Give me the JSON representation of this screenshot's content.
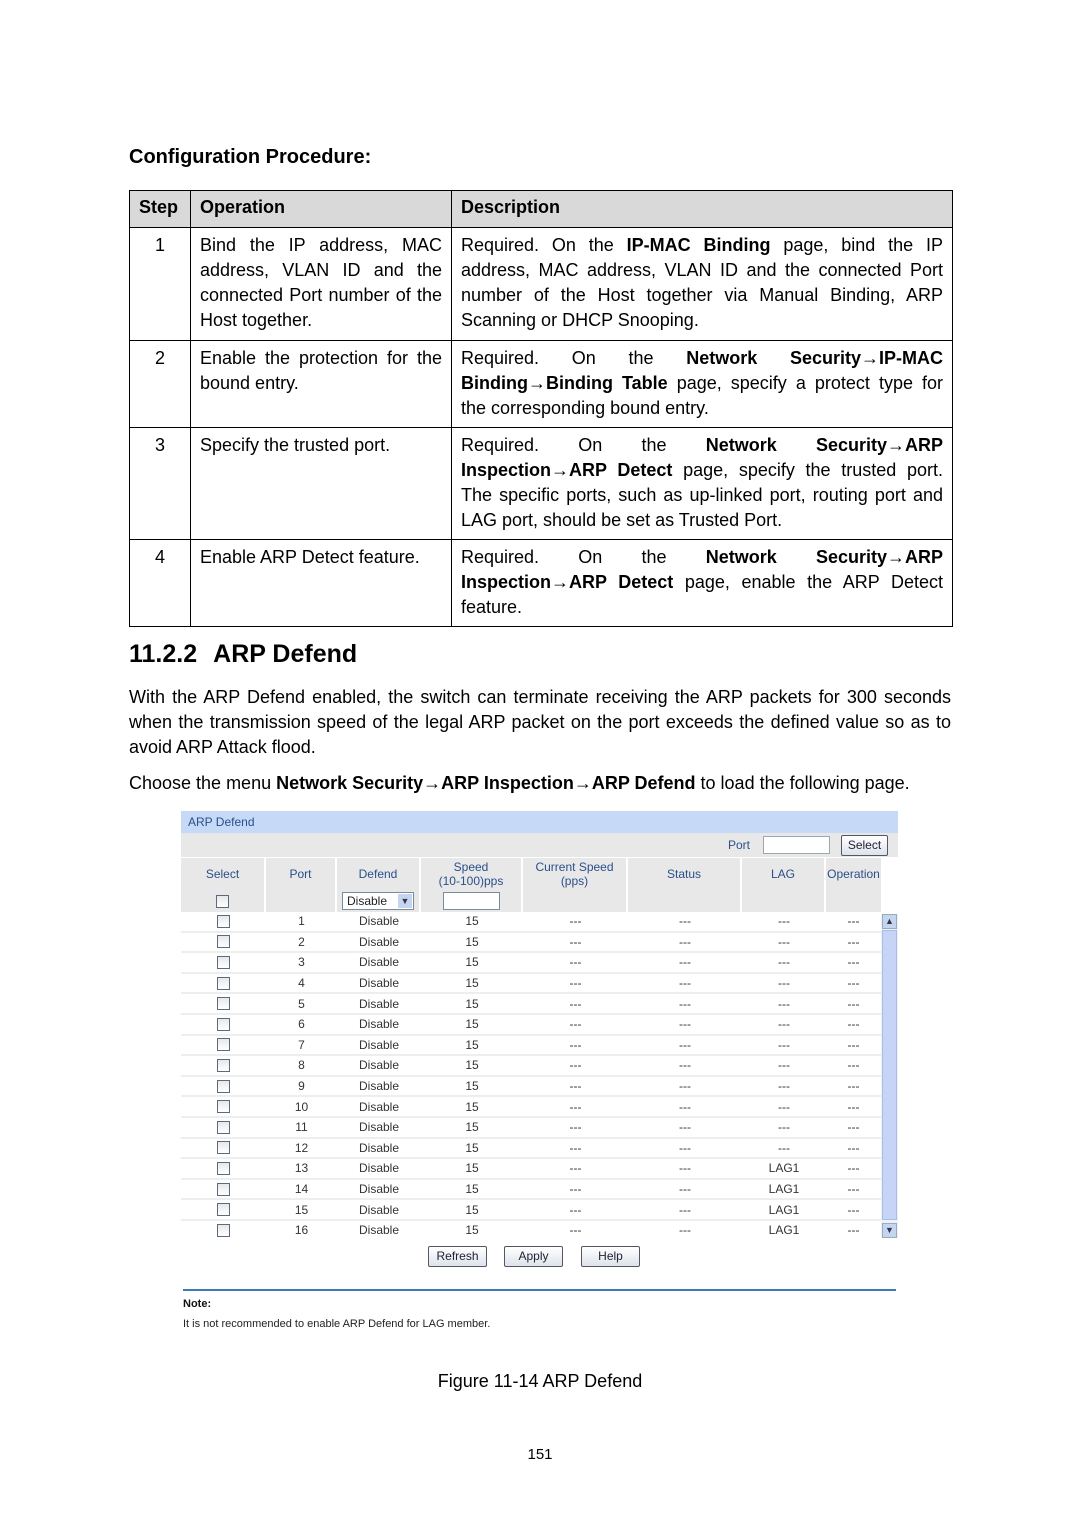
{
  "config_title": "Configuration Procedure:",
  "table": {
    "headers": [
      "Step",
      "Operation",
      "Description"
    ],
    "rows": [
      {
        "step": "1",
        "operation": "Bind the IP address, MAC address, VLAN ID and the connected Port number of the Host together.",
        "description": [
          {
            "t": "Required. On the "
          },
          {
            "t": "IP-MAC Binding",
            "b": true
          },
          {
            "t": " page, bind the IP address, MAC address, VLAN ID and the connected Port number of the Host together via Manual Binding, ARP Scanning or DHCP Snooping."
          }
        ]
      },
      {
        "step": "2",
        "operation": "Enable the protection for the bound entry.",
        "description": [
          {
            "t": "Required. On the "
          },
          {
            "t": "Network Security→IP-MAC Binding→Binding Table",
            "b": true
          },
          {
            "t": " page, specify a protect type for the corresponding bound entry."
          }
        ]
      },
      {
        "step": "3",
        "operation": "Specify the trusted port.",
        "description": [
          {
            "t": "Required. On the "
          },
          {
            "t": "Network Security→ARP Inspection→ARP Detect",
            "b": true
          },
          {
            "t": " page, specify the trusted port. The specific ports, such as up-linked port, routing port and LAG port, should be set as Trusted Port."
          }
        ]
      },
      {
        "step": "4",
        "operation": "Enable ARP Detect feature.",
        "description": [
          {
            "t": "Required. On the "
          },
          {
            "t": "Network Security→ARP Inspection→ARP Detect",
            "b": true
          },
          {
            "t": " page, enable the ARP Detect feature."
          }
        ]
      }
    ]
  },
  "section": {
    "number": "11.2.2",
    "title": "ARP Defend"
  },
  "paragraphs": [
    [
      {
        "t": "With the ARP Defend enabled, the switch can terminate receiving the ARP packets for 300 seconds when the transmission speed of the legal ARP packet on the port exceeds the defined value so as to avoid ARP Attack flood."
      }
    ],
    [
      {
        "t": "Choose the menu "
      },
      {
        "t": "Network Security→ARP Inspection→ARP Defend",
        "b": true
      },
      {
        "t": " to load the following page."
      }
    ]
  ],
  "ui": {
    "title": "ARP Defend",
    "port_label": "Port",
    "port_value": "",
    "select_button": "Select",
    "columns": [
      "Select",
      "Port",
      "Defend",
      "Speed\n(10-100)pps",
      "Current Speed\n(pps)",
      "Status",
      "LAG",
      "Operation"
    ],
    "filter": {
      "defend": "Disable",
      "speed": ""
    },
    "rows": [
      {
        "port": "1",
        "defend": "Disable",
        "speed": "15",
        "current": "---",
        "status": "---",
        "lag": "---",
        "op": "---"
      },
      {
        "port": "2",
        "defend": "Disable",
        "speed": "15",
        "current": "---",
        "status": "---",
        "lag": "---",
        "op": "---"
      },
      {
        "port": "3",
        "defend": "Disable",
        "speed": "15",
        "current": "---",
        "status": "---",
        "lag": "---",
        "op": "---"
      },
      {
        "port": "4",
        "defend": "Disable",
        "speed": "15",
        "current": "---",
        "status": "---",
        "lag": "---",
        "op": "---"
      },
      {
        "port": "5",
        "defend": "Disable",
        "speed": "15",
        "current": "---",
        "status": "---",
        "lag": "---",
        "op": "---"
      },
      {
        "port": "6",
        "defend": "Disable",
        "speed": "15",
        "current": "---",
        "status": "---",
        "lag": "---",
        "op": "---"
      },
      {
        "port": "7",
        "defend": "Disable",
        "speed": "15",
        "current": "---",
        "status": "---",
        "lag": "---",
        "op": "---"
      },
      {
        "port": "8",
        "defend": "Disable",
        "speed": "15",
        "current": "---",
        "status": "---",
        "lag": "---",
        "op": "---"
      },
      {
        "port": "9",
        "defend": "Disable",
        "speed": "15",
        "current": "---",
        "status": "---",
        "lag": "---",
        "op": "---"
      },
      {
        "port": "10",
        "defend": "Disable",
        "speed": "15",
        "current": "---",
        "status": "---",
        "lag": "---",
        "op": "---"
      },
      {
        "port": "11",
        "defend": "Disable",
        "speed": "15",
        "current": "---",
        "status": "---",
        "lag": "---",
        "op": "---"
      },
      {
        "port": "12",
        "defend": "Disable",
        "speed": "15",
        "current": "---",
        "status": "---",
        "lag": "---",
        "op": "---"
      },
      {
        "port": "13",
        "defend": "Disable",
        "speed": "15",
        "current": "---",
        "status": "---",
        "lag": "LAG1",
        "op": "---"
      },
      {
        "port": "14",
        "defend": "Disable",
        "speed": "15",
        "current": "---",
        "status": "---",
        "lag": "LAG1",
        "op": "---"
      },
      {
        "port": "15",
        "defend": "Disable",
        "speed": "15",
        "current": "---",
        "status": "---",
        "lag": "LAG1",
        "op": "---"
      },
      {
        "port": "16",
        "defend": "Disable",
        "speed": "15",
        "current": "---",
        "status": "---",
        "lag": "LAG1",
        "op": "---"
      }
    ],
    "buttons": {
      "refresh": "Refresh",
      "apply": "Apply",
      "help": "Help"
    },
    "note_title": "Note:",
    "note_text": "It is not recommended to enable ARP Defend for LAG member.",
    "colors": {
      "title_bar": "#c6d9f7",
      "header_text": "#2a4f8a",
      "note_line": "#3d7ab8"
    }
  },
  "caption": "Figure 11-14 ARP Defend",
  "page_number": "151"
}
